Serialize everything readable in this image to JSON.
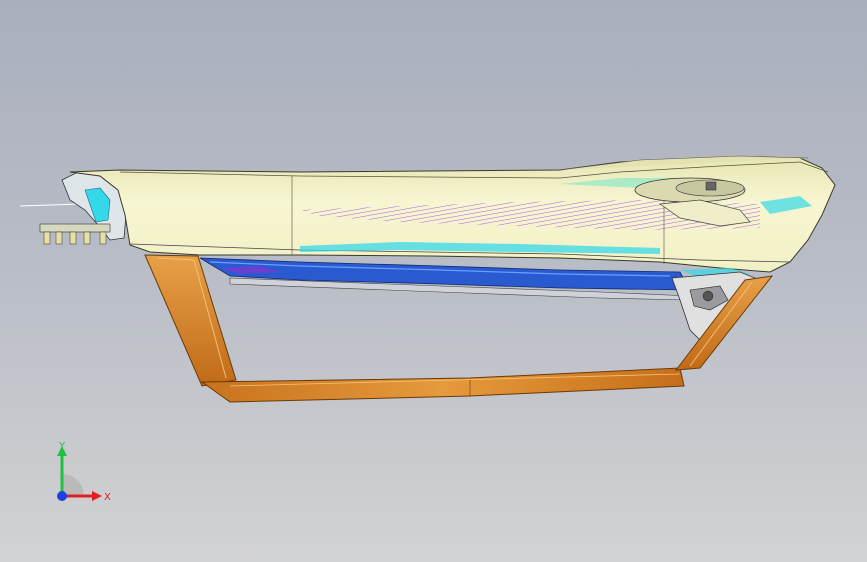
{
  "viewport": {
    "background_top": "#a9afbd",
    "background_bottom": "#d2d3d6"
  },
  "model": {
    "name": "dashboard-cad-model",
    "colors": {
      "main_panel": "#f4f4c8",
      "panel_edge": "#3a3a2a",
      "wood_trim": "#d98a2e",
      "cyan_highlight": "#35d8e8",
      "purple_hatch": "#a040e0",
      "blue_duct": "#2a5ad0"
    }
  },
  "triad": {
    "x_label": "X",
    "y_label": "Y",
    "x_color": "#e02020",
    "y_color": "#20c040",
    "z_color": "#2040e0"
  }
}
